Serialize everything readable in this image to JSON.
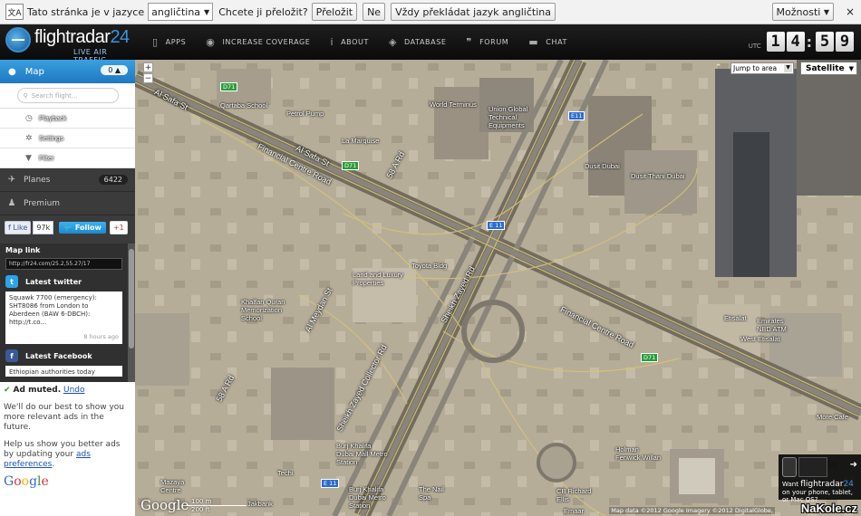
{
  "translate_bar": {
    "text1": "Tato stránka je v jazyce",
    "language": "angličtina",
    "text2": "Chcete ji přeložit?",
    "translate_button": "Přeložit",
    "no_button": "Ne",
    "always_button": "Vždy překládat jazyk angličtina",
    "options": "Možnosti",
    "close": "×"
  },
  "header": {
    "logo_main": "flightradar",
    "logo_num": "24",
    "logo_sub": "LIVE AIR TRAFFIC",
    "nav": [
      {
        "label": "APPS",
        "icon": "▯"
      },
      {
        "label": "INCREASE COVERAGE",
        "icon": "◉"
      },
      {
        "label": "ABOUT",
        "icon": "i"
      },
      {
        "label": "DATABASE",
        "icon": "◈"
      },
      {
        "label": "FORUM",
        "icon": "❞"
      },
      {
        "label": "CHAT",
        "icon": "▬"
      }
    ],
    "clock": {
      "utc": "UTC",
      "h1": "1",
      "h2": "4",
      "m1": "5",
      "m2": "9"
    }
  },
  "sidebar": {
    "map_label": "Map",
    "map_count": "0 ▲",
    "search_placeholder": "Search flight...",
    "submenu": [
      "Playback",
      "Settings",
      "Filter"
    ],
    "planes_label": "Planes",
    "planes_count": "6422",
    "premium_label": "Premium",
    "social": {
      "like": "Like",
      "like_count": "97k",
      "follow": "Follow",
      "plus": "+1"
    },
    "map_link_title": "Map link",
    "map_link_value": "http://fr24.com/25.2,55.27/17",
    "latest_twitter": "Latest twitter",
    "tweet": "Squawk 7700 (emergency): SHT8086 from London to Aberdeen (BAW 6-DBCH): http://t.co...",
    "tweet_ago": "8 hours ago",
    "latest_facebook": "Latest Facebook",
    "fb_text": "Ethiopian authorities today"
  },
  "ad": {
    "muted": "Ad muted.",
    "undo": "Undo",
    "p1": "We'll do our best to show you more relevant ads in the future.",
    "p2": "Help us show you better ads by updating your",
    "p2_link": "ads preferences",
    "google": [
      "G",
      "o",
      "o",
      "g",
      "l",
      "e"
    ]
  },
  "map": {
    "jump_to": "Jump to area",
    "satellite": "Satellite",
    "zoom_in": "+",
    "zoom_out": "−",
    "google": "Google",
    "scale_m": "100 m",
    "scale_ft": "200 ft",
    "credit": "Map data ©2012 Google Imagery ©2012 DigitalGlobe,",
    "promo_want": "Want",
    "promo_brand": "flightradar",
    "promo_num": "24",
    "promo_text": "on your phone, tablet, or Mac OS?",
    "watermark": "NaKole.cz",
    "labels": [
      "Qartaba School",
      "Petrol Pump",
      "La Marquise",
      "Union Global Technical Equipments",
      "Dusit Dubai",
      "Dusit Thani Dubai",
      "Toyota Bldg",
      "Larid and Luxury Properties",
      "Khalfan Quran Memorization School",
      "Etisalat",
      "Emirates NBD ATM",
      "West Etisalat",
      "Holman Fenwick Willan",
      "Burj Khalifa Dubai Mall Metro Station",
      "Burj Khalifa Dubai Metro Station",
      "The Nail Spa",
      "CB Richard Ellis",
      "Emaar",
      "Mazaya Centre",
      "More Cafe",
      "Techi",
      "Jakbank",
      "Financial Centre Road",
      "Al Safa St",
      "Sheikh Zayed Rd",
      "Al Meydan St",
      "58 A Rd",
      "Sheikh Zayed Collector Rd",
      "World Terminus"
    ],
    "route_markers": [
      "D71",
      "E11",
      "E 11",
      "D71"
    ]
  }
}
